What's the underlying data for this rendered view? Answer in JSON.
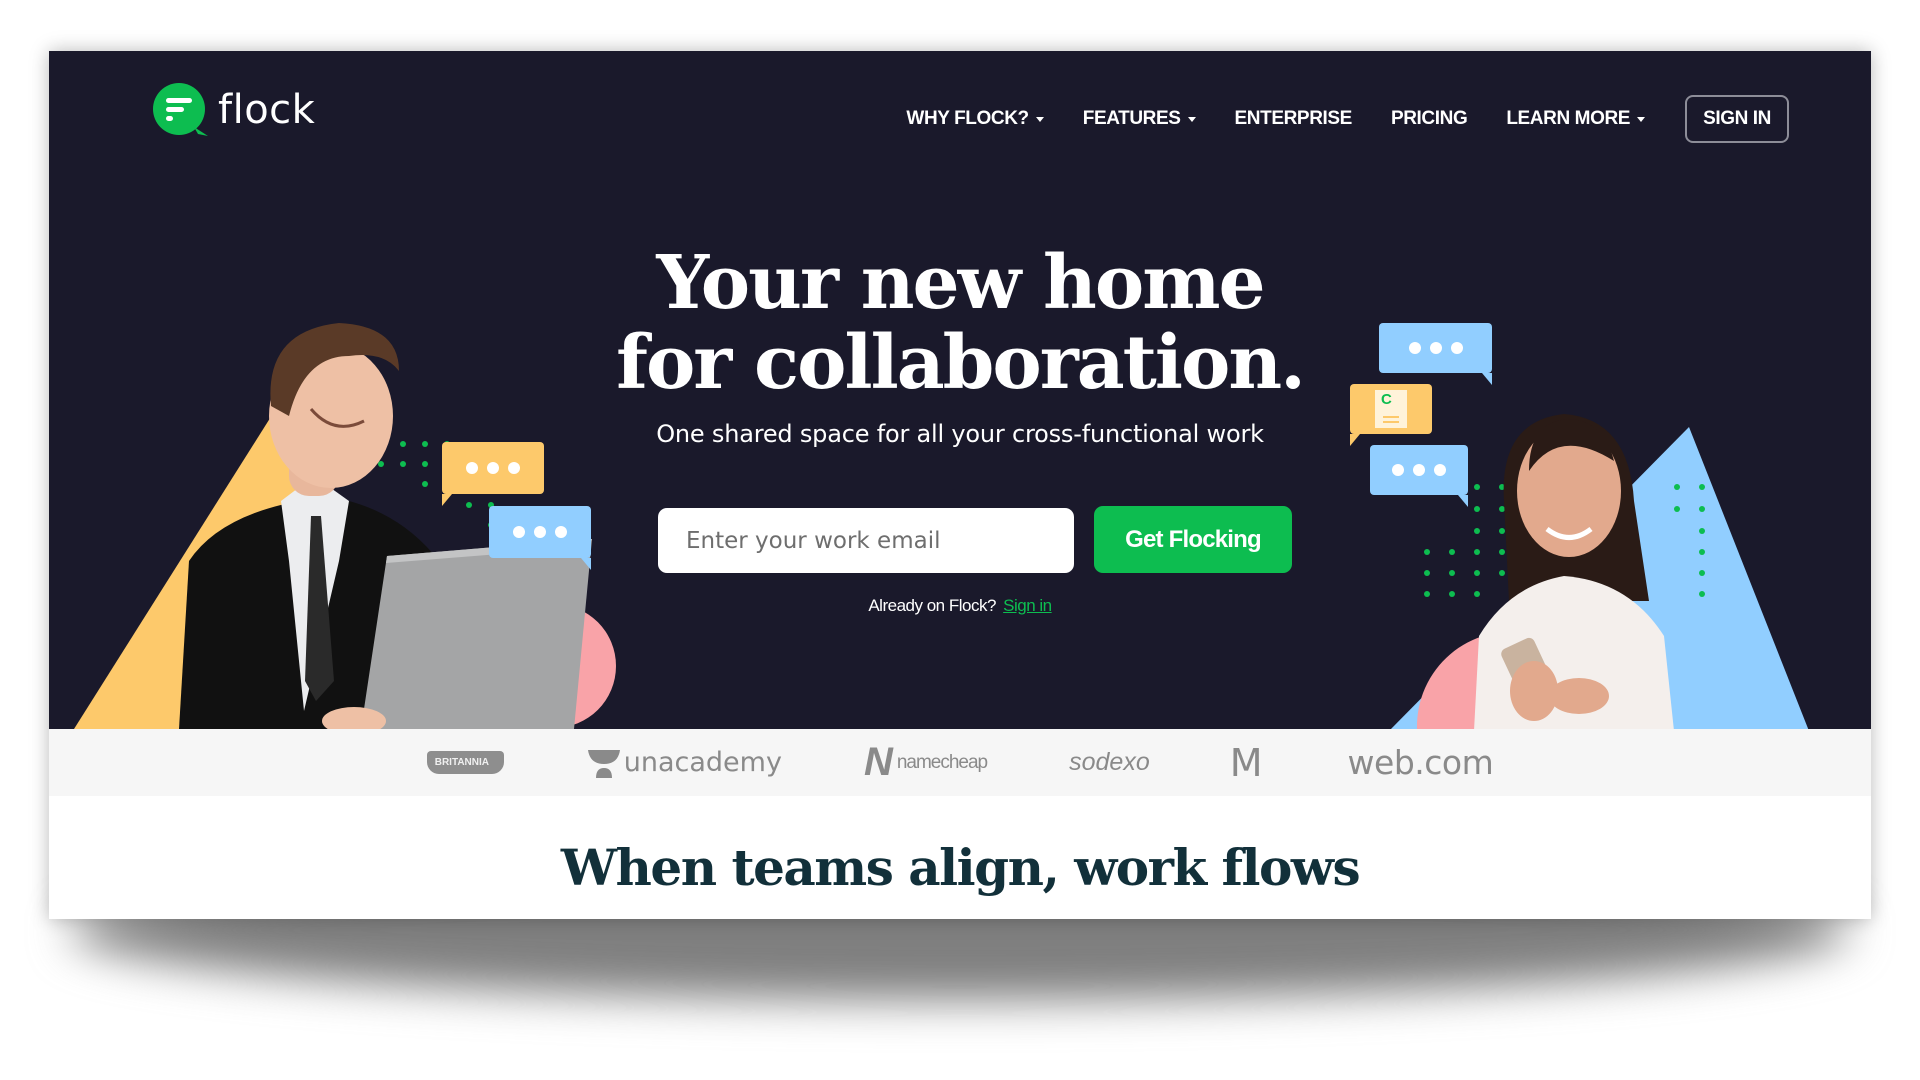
{
  "header": {
    "logo_text": "flock",
    "nav": [
      {
        "label": "WHY FLOCK?",
        "has_dropdown": true
      },
      {
        "label": "FEATURES",
        "has_dropdown": true
      },
      {
        "label": "ENTERPRISE",
        "has_dropdown": false
      },
      {
        "label": "PRICING",
        "has_dropdown": false
      },
      {
        "label": "LEARN MORE",
        "has_dropdown": true
      }
    ],
    "sign_in_label": "SIGN IN"
  },
  "hero": {
    "title_line1": "Your new home",
    "title_line2": "for collaboration.",
    "subtitle": "One shared space for all your cross-functional work",
    "email_placeholder": "Enter your work email",
    "email_value": "",
    "cta_label": "Get Flocking",
    "already_text": "Already on Flock?",
    "sign_in_link": "Sign in"
  },
  "logos": {
    "britannia": "BRITANNIA",
    "unacademy": "unacademy",
    "namecheap_mark": "N",
    "namecheap": "namecheap",
    "sodexo": "sodexo",
    "mcdonalds": "M",
    "webcom": "web.com"
  },
  "section": {
    "title": "When teams align, work flows"
  },
  "colors": {
    "hero_bg": "#1a192b",
    "brand_green": "#0dbd50",
    "bubble_yellow": "#fdc96b",
    "bubble_blue": "#91ceff",
    "accent_pink": "#f9a3a8",
    "heading_dark": "#12303a"
  }
}
